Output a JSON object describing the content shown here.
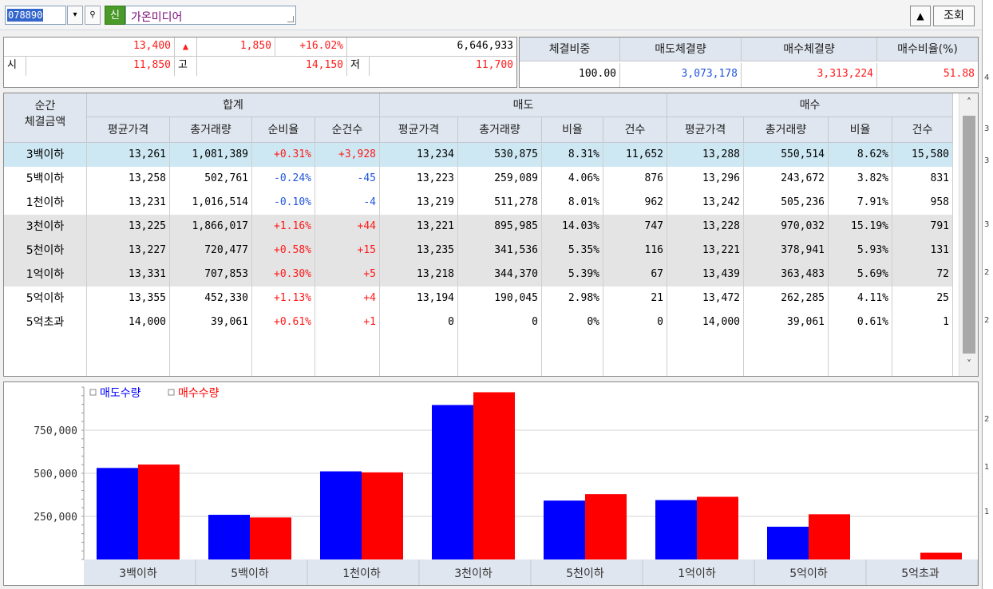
{
  "toolbar": {
    "stock_code": "078890",
    "dropdown_icon": "▾",
    "search_icon": "⚲",
    "badge": "신",
    "stock_name": "가온미디어",
    "up_icon": "▲",
    "query_label": "조회"
  },
  "summary": {
    "price": "13,400",
    "change_arrow": "▲",
    "change": "1,850",
    "change_pct": "+16.02%",
    "volume": "6,646,933",
    "open_label": "시",
    "open": "11,850",
    "high_label": "고",
    "high": "14,150",
    "low_label": "저",
    "low": "11,700"
  },
  "ratio_box": {
    "headers": [
      "체결비중",
      "매도체결량",
      "매수체결량",
      "매수비율(%)"
    ],
    "values": [
      "100.00",
      "3,073,178",
      "3,313,224",
      "51.88"
    ]
  },
  "table": {
    "corner_label_1": "순간",
    "corner_label_2": "체결금액",
    "groups": [
      "합계",
      "매도",
      "매수"
    ],
    "columns": [
      "평균가격",
      "총거래량",
      "순비율",
      "순건수",
      "평균가격",
      "총거래량",
      "비율",
      "건수",
      "평균가격",
      "총거래량",
      "비율",
      "건수"
    ],
    "rows": [
      {
        "label": "3백이하",
        "cells": [
          "13,261",
          "1,081,389",
          "+0.31%",
          "+3,928",
          "13,234",
          "530,875",
          "8.31%",
          "11,652",
          "13,288",
          "550,514",
          "8.62%",
          "15,580"
        ]
      },
      {
        "label": "5백이하",
        "cells": [
          "13,258",
          "502,761",
          "-0.24%",
          "-45",
          "13,223",
          "259,089",
          "4.06%",
          "876",
          "13,296",
          "243,672",
          "3.82%",
          "831"
        ]
      },
      {
        "label": "1천이하",
        "cells": [
          "13,231",
          "1,016,514",
          "-0.10%",
          "-4",
          "13,219",
          "511,278",
          "8.01%",
          "962",
          "13,242",
          "505,236",
          "7.91%",
          "958"
        ]
      },
      {
        "label": "3천이하",
        "cells": [
          "13,225",
          "1,866,017",
          "+1.16%",
          "+44",
          "13,221",
          "895,985",
          "14.03%",
          "747",
          "13,228",
          "970,032",
          "15.19%",
          "791"
        ]
      },
      {
        "label": "5천이하",
        "cells": [
          "13,227",
          "720,477",
          "+0.58%",
          "+15",
          "13,235",
          "341,536",
          "5.35%",
          "116",
          "13,221",
          "378,941",
          "5.93%",
          "131"
        ]
      },
      {
        "label": "1억이하",
        "cells": [
          "13,331",
          "707,853",
          "+0.30%",
          "+5",
          "13,218",
          "344,370",
          "5.39%",
          "67",
          "13,439",
          "363,483",
          "5.69%",
          "72"
        ]
      },
      {
        "label": "5억이하",
        "cells": [
          "13,355",
          "452,330",
          "+1.13%",
          "+4",
          "13,194",
          "190,045",
          "2.98%",
          "21",
          "13,472",
          "262,285",
          "4.11%",
          "25"
        ]
      },
      {
        "label": "5억초과",
        "cells": [
          "14,000",
          "39,061",
          "+0.61%",
          "+1",
          "0",
          "0",
          "0%",
          "0",
          "14,000",
          "39,061",
          "0.61%",
          "1"
        ]
      }
    ]
  },
  "scrollbar": {
    "up": "˄",
    "down": "˅"
  },
  "chart_data": {
    "type": "bar",
    "categories": [
      "3백이하",
      "5백이하",
      "1천이하",
      "3천이하",
      "5천이하",
      "1억이하",
      "5억이하",
      "5억초과"
    ],
    "series": [
      {
        "name": "매도수량",
        "color": "#0000ff",
        "values": [
          530875,
          259089,
          511278,
          895985,
          341536,
          344370,
          190045,
          0
        ]
      },
      {
        "name": "매수수량",
        "color": "#ff0000",
        "values": [
          550514,
          243672,
          505236,
          970032,
          378941,
          363483,
          262285,
          39061
        ]
      }
    ],
    "yticks": [
      250000,
      500000,
      750000
    ],
    "ytick_labels": [
      "250,000",
      "500,000",
      "750,000"
    ],
    "ylim": [
      0,
      1000000
    ],
    "legend_position": "top-left",
    "grid": true
  },
  "right_strip": {
    "marks": [
      "4",
      "3",
      "3",
      "3",
      "2",
      "2",
      "2",
      "1",
      "1"
    ]
  }
}
